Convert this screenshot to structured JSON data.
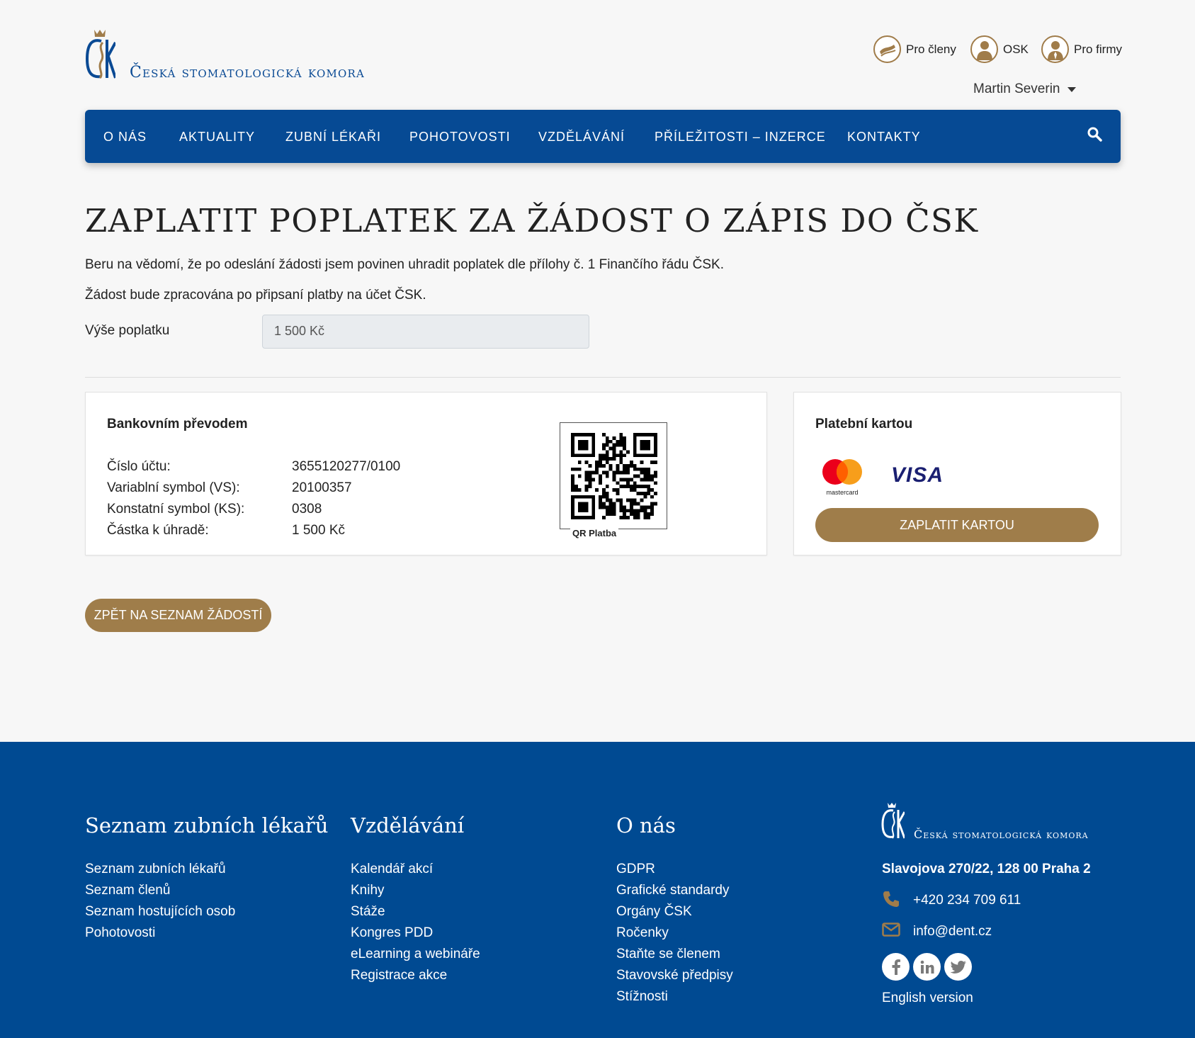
{
  "header": {
    "logo_text": "Česká stomatologická komora",
    "top_links": [
      {
        "label": "Pro členy",
        "icon": "hands-icon"
      },
      {
        "label": "OSK",
        "icon": "person-icon"
      },
      {
        "label": "Pro firmy",
        "icon": "businessman-icon"
      }
    ],
    "user_name": "Martin Severin"
  },
  "nav": {
    "items": [
      "O NÁS",
      "AKTUALITY",
      "ZUBNÍ LÉKAŘI",
      "POHOTOVOSTI",
      "VZDĚLÁVÁNÍ",
      "PŘÍLEŽITOSTI – INZERCE",
      "KONTAKTY"
    ],
    "search_icon": "search-icon"
  },
  "main": {
    "title": "ZAPLATIT POPLATEK ZA ŽÁDOST O ZÁPIS DO ČSK",
    "paragraph1": "Beru na vědomí, že po odeslání žádosti jsem povinen uhradit poplatek dle přílohy č. 1 Finančího řádu ČSK.",
    "paragraph2": "Žádost bude zpracována po připsaní platby na účet ČSK.",
    "fee_label": "Výše poplatku",
    "fee_value": "1 500 Kč",
    "bank": {
      "title": "Bankovním převodem",
      "rows": [
        {
          "label": "Číslo účtu:",
          "value": "3655120277/0100"
        },
        {
          "label": "Variablní symbol (VS):",
          "value": "20100357"
        },
        {
          "label": "Konstatní symbol (KS):",
          "value": "0308"
        },
        {
          "label": "Částka k úhradě:",
          "value": "1 500 Kč"
        }
      ],
      "qr_caption": "QR Platba"
    },
    "card": {
      "title": "Platební kartou",
      "mastercard_text": "mastercard",
      "visa_text": "VISA",
      "pay_button": "ZAPLATIT KARTOU"
    },
    "back_button": "ZPĚT NA SEZNAM ŽÁDOSTÍ"
  },
  "footer": {
    "col1": {
      "heading": "Seznam zubních lékařů",
      "links": [
        "Seznam zubních lékařů",
        "Seznam členů",
        "Seznam hostujících osob",
        "Pohotovosti"
      ]
    },
    "col2": {
      "heading": "Vzdělávání",
      "links": [
        "Kalendář akcí",
        "Knihy",
        "Stáže",
        "Kongres PDD",
        "eLearning a webináře",
        "Registrace akce"
      ]
    },
    "col3": {
      "heading": "O nás",
      "links": [
        "GDPR",
        "Grafické standardy",
        "Orgány ČSK",
        "Ročenky",
        "Staňte se členem",
        "Stavovské předpisy",
        "Stížnosti"
      ]
    },
    "logo_text": "Česká stomatologická komora",
    "address": "Slavojova 270/22, 128 00 Praha 2",
    "phone": "+420 234 709 611",
    "email": "info@dent.cz",
    "english": "English version",
    "social": [
      "facebook-icon",
      "linkedin-icon",
      "twitter-icon"
    ],
    "accent": "#a07c4a",
    "bg": "#004a92"
  }
}
